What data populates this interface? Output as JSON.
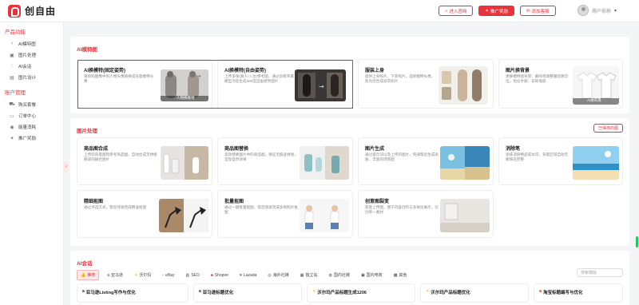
{
  "header": {
    "logo_text": "创自由",
    "buttons": [
      {
        "label": "进入官网",
        "icon": "home-icon"
      },
      {
        "label": "推广奖励",
        "icon": "gift-icon"
      },
      {
        "label": "添加客服",
        "icon": "chat-icon"
      }
    ],
    "username": "用户名称",
    "accent_color": "#e8323c"
  },
  "sidebar": {
    "sections": [
      {
        "title": "产品功能",
        "items": [
          {
            "label": "AI模特图",
            "icon": "person-icon"
          },
          {
            "label": "图片处理",
            "icon": "image-icon"
          },
          {
            "label": "AI会话",
            "icon": "chat-icon"
          },
          {
            "label": "图片设计",
            "icon": "design-icon"
          }
        ]
      },
      {
        "title": "账户管理",
        "items": [
          {
            "label": "购买套餐",
            "icon": "cart-icon"
          },
          {
            "label": "订单中心",
            "icon": "order-icon"
          },
          {
            "label": "能量消耗",
            "icon": "energy-icon"
          },
          {
            "label": "推广奖励",
            "icon": "gift-icon"
          }
        ]
      }
    ]
  },
  "model_panel": {
    "title": "AI模特图",
    "cards": [
      {
        "title": "AI换模特(固定姿势)",
        "desc": "将目标图像中的人物头像替换成任意模特头像",
        "thumb_caption": "人物换模特"
      },
      {
        "title": "AI换模特(自由姿势)",
        "desc": "上传多张(真人/人台)参考图，通过训练专属模型为您生成360度自由姿势图片"
      },
      {
        "title": "服装上身",
        "desc": "提供上身照片、下装照片，选择模特头像，及为您合成穿衣照片"
      },
      {
        "title": "图片换背景",
        "desc": "更换模特图背景：删除或调整服装阴印位，优化手部、去除瑕疵",
        "thumb_caption": "AI换背景"
      }
    ]
  },
  "image_panel": {
    "title": "图片处理",
    "link_label": "已保存的图",
    "cards": [
      {
        "title": "商品图合成",
        "desc": "上传的背景图和参考商品图，自动合成无拼接痕迹的融合图片"
      },
      {
        "title": "商品图替换",
        "desc": "高效替换图片中的商品图，保证无痕迹拼接，呈现自然效果"
      },
      {
        "title": "图片生成",
        "desc": "通过提示词以及上传的图片，快速帮您生成高质、丰富的场景图"
      },
      {
        "title": "消除笔",
        "desc": "涂抹消除物品或水印，背景区域自动无痕填充完整"
      },
      {
        "title": "精细抠图",
        "desc": "通过点选方式，帮您快速完成精准抠图"
      },
      {
        "title": "批量抠图",
        "desc": "通过一键批量抠图，帮您快速完成多张照片抠图"
      },
      {
        "title": "创意图裂变",
        "desc": "裂变上传图，便于内容创作与多样化展示，衍创单一素材"
      }
    ]
  },
  "chat_panel": {
    "title": "AI会话",
    "tabs": [
      {
        "label": "推荐",
        "icon": "thumb-icon",
        "active": true
      },
      {
        "label": "亚马逊",
        "icon": "amazon-icon"
      },
      {
        "label": "沃尔玛",
        "icon": "walmart-icon"
      },
      {
        "label": "eBay",
        "icon": "ebay-icon"
      },
      {
        "label": "SEO",
        "icon": "seo-icon"
      },
      {
        "label": "Shopee",
        "icon": "shopee-icon"
      },
      {
        "label": "Lazada",
        "icon": "lazada-icon"
      },
      {
        "label": "海外社媒",
        "icon": "social-icon"
      },
      {
        "label": "独立站",
        "icon": "site-icon"
      },
      {
        "label": "国内社媒",
        "icon": "social-cn-icon"
      },
      {
        "label": "国内电商",
        "icon": "shop-icon"
      },
      {
        "label": "其他",
        "icon": "grid-icon"
      }
    ],
    "search_placeholder": "搜索模版",
    "tools": [
      {
        "label": "亚马逊Listing写作与优化",
        "icon": "amazon-icon"
      },
      {
        "label": "亚马逊标题优化",
        "icon": "amazon-icon"
      },
      {
        "label": "沃尔玛产品标题生成1206",
        "icon": "walmart-icon"
      },
      {
        "label": "沃尔玛产品标题优化",
        "icon": "walmart-icon"
      },
      {
        "label": "淘宝标题编写与优化",
        "icon": "taobao-icon"
      }
    ]
  }
}
